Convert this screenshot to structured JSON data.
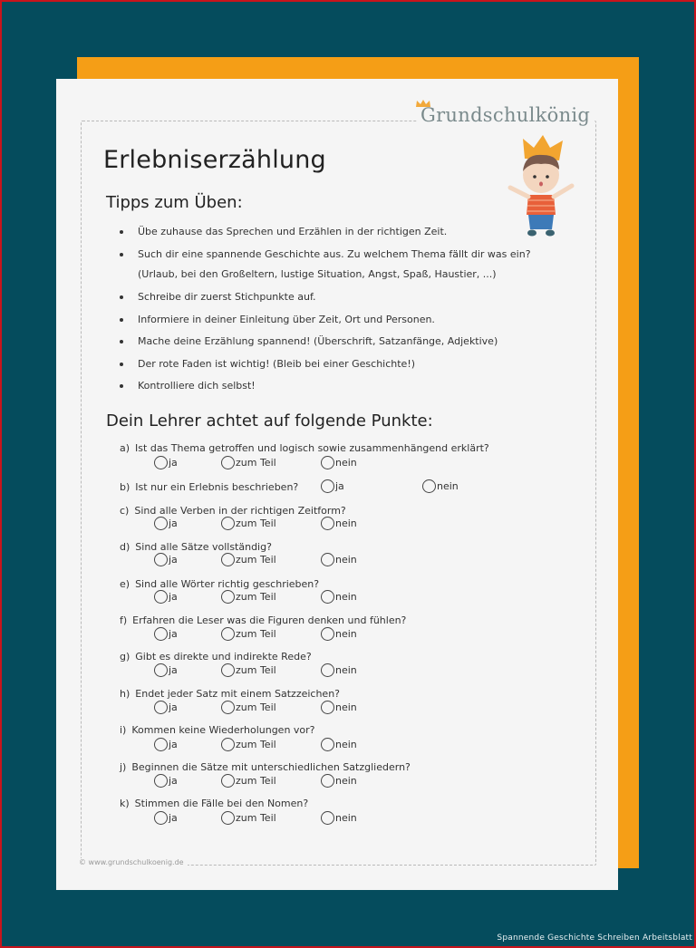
{
  "brand": {
    "logo_text": "Grundschulkönig",
    "footer_text": "© www.grundschulkoenig.de",
    "colors": {
      "background": "#054c5d",
      "accent_orange": "#f59e16",
      "paper": "#f5f5f5",
      "frame_red": "#c8141c",
      "logo_gray": "#7a8a8c"
    }
  },
  "worksheet": {
    "title": "Erlebniserzählung",
    "tips_heading": "Tipps zum Üben:",
    "tips": [
      "Übe zuhause das Sprechen und Erzählen in der richtigen Zeit.",
      "Such dir eine spannende Geschichte aus. Zu welchem Thema fällt dir was ein?",
      "(Urlaub, bei den Großeltern, lustige Situation, Angst, Spaß, Haustier, ...)",
      "Schreibe dir zuerst Stichpunkte auf.",
      "Informiere in deiner Einleitung über Zeit, Ort und Personen.",
      "Mache deine Erzählung spannend! (Überschrift, Satzanfänge, Adjektive)",
      "Der rote Faden ist wichtig! (Bleib bei einer Geschichte!)",
      "Kontrolliere dich selbst!"
    ],
    "checklist_heading": "Dein Lehrer achtet auf folgende Punkte:",
    "options": {
      "yes": "ja",
      "partly": "zum Teil",
      "no": "nein"
    },
    "questions": [
      {
        "label": "a)",
        "text": "Ist das Thema getroffen und logisch sowie zusammenhängend erklärt?"
      },
      {
        "label": "b)",
        "text": "Ist nur ein Erlebnis beschrieben?"
      },
      {
        "label": "c)",
        "text": "Sind alle Verben in der richtigen Zeitform?"
      },
      {
        "label": "d)",
        "text": "Sind alle Sätze vollständig?"
      },
      {
        "label": "e)",
        "text": "Sind alle Wörter richtig geschrieben?"
      },
      {
        "label": "f)",
        "text": "Erfahren die Leser was die Figuren denken und fühlen?"
      },
      {
        "label": "g)",
        "text": "Gibt es direkte und indirekte Rede?"
      },
      {
        "label": "h)",
        "text": "Endet jeder Satz mit einem Satzzeichen?"
      },
      {
        "label": "i)",
        "text": "Kommen keine Wiederholungen vor?"
      },
      {
        "label": "j)",
        "text": "Beginnen die Sätze mit unterschiedlichen Satzgliedern?"
      },
      {
        "label": "k)",
        "text": "Stimmen die Fälle bei den Nomen?"
      }
    ]
  },
  "caption": "Spannende Geschichte Schreiben Arbeitsblatt"
}
